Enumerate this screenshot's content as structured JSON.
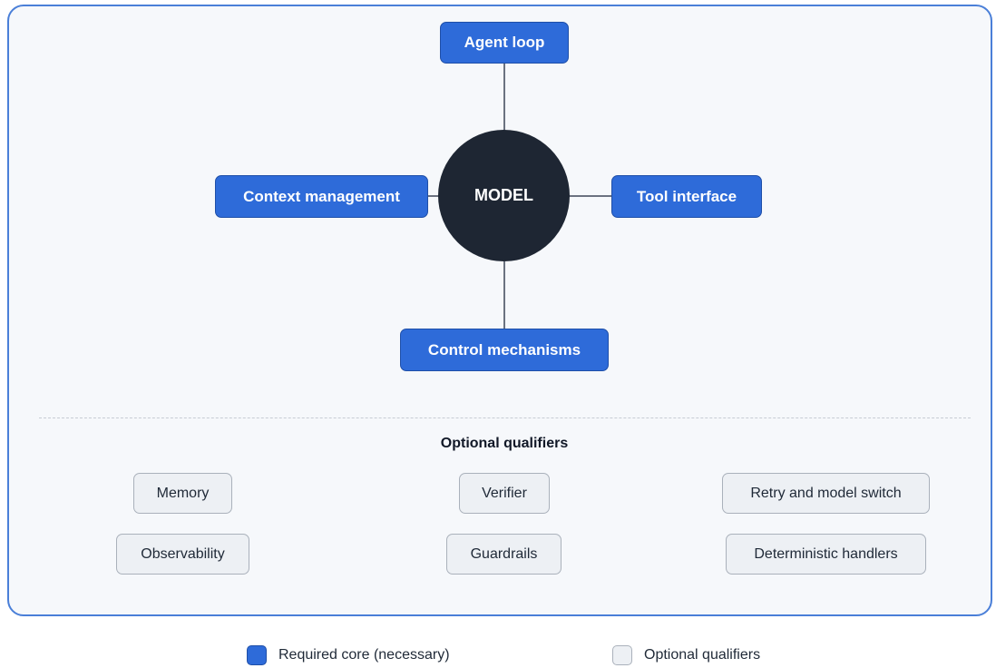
{
  "diagram": {
    "center": "MODEL",
    "required_core": [
      "Agent loop",
      "Context management",
      "Tool interface",
      "Control mechanisms"
    ],
    "optional_title": "Optional qualifiers",
    "optional_items": [
      "Memory",
      "Verifier",
      "Retry and model switch",
      "Observability",
      "Guardrails",
      "Deterministic handlers"
    ]
  },
  "legend": {
    "core_label": "Required core (necessary)",
    "optional_label": "Optional qualifiers"
  },
  "colors": {
    "core_fill": "#2e6bd9",
    "model_fill": "#1e2633",
    "optional_fill": "#edf0f4",
    "frame_border": "#4a7fd8"
  }
}
